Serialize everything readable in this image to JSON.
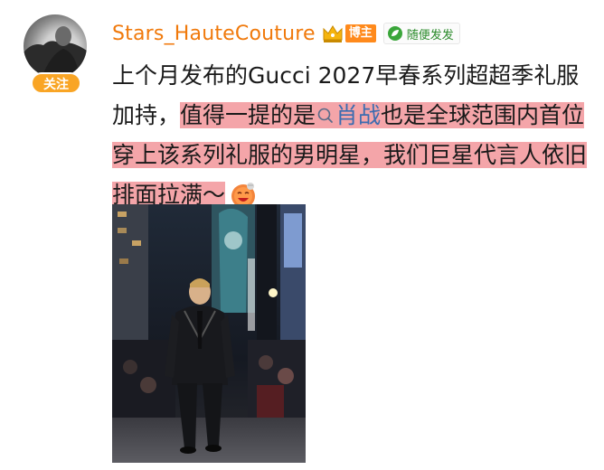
{
  "user": {
    "name": "Stars_HauteCouture",
    "follow_label": "关注",
    "badge_label": "博主",
    "source_label": "随便发发"
  },
  "post": {
    "text_part1": "上个月发布的Gucci 2027早春系列超超季礼服加持，",
    "text_highlight_a": "值得一提的是",
    "topic": "肖战",
    "text_highlight_b": "也是全球范围内首位穿上该系列礼服的男明星，我们巨星代言人依旧排面拉满～"
  },
  "icons": {
    "crown": "crown-icon",
    "leaf": "leaf-icon",
    "search": "search-icon",
    "emoji": "smile-emoji-icon"
  },
  "colors": {
    "username": "#f0790b",
    "follow": "#f9a525",
    "badge": "#ff8a1c",
    "highlight": "#f4a5a9"
  }
}
